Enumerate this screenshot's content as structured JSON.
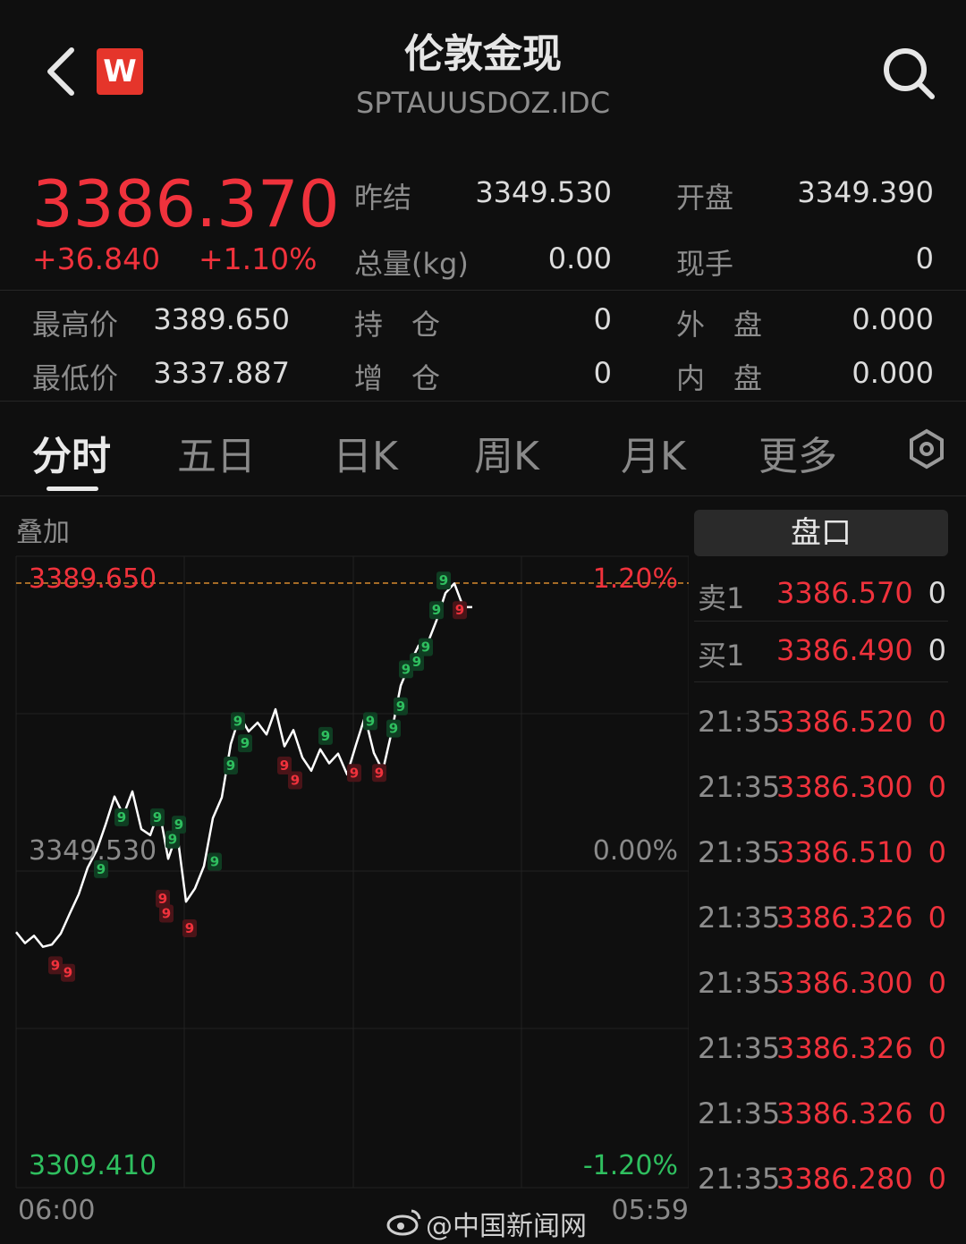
{
  "header": {
    "title": "伦敦金现",
    "subtitle": "SPTAUUSDOZ.IDC",
    "logo_text": "W"
  },
  "quote": {
    "price": "3386.370",
    "change": "+36.840",
    "change_pct": "+1.10%",
    "stats_row1": [
      {
        "label": "昨结",
        "value": "3349.530"
      },
      {
        "label": "开盘",
        "value": "3349.390"
      }
    ],
    "stats_row2": [
      {
        "label": "总量(kg)",
        "value": "0.00"
      },
      {
        "label": "现手",
        "value": "0"
      }
    ],
    "stats_row3": [
      {
        "label": "最高价",
        "value": "3389.650"
      },
      {
        "label": "持　仓",
        "value": "0"
      },
      {
        "label": "外　盘",
        "value": "0.000"
      }
    ],
    "stats_row4": [
      {
        "label": "最低价",
        "value": "3337.887"
      },
      {
        "label": "增　仓",
        "value": "0"
      },
      {
        "label": "内　盘",
        "value": "0.000"
      }
    ]
  },
  "tabs": [
    {
      "label": "分时",
      "active": true
    },
    {
      "label": "五日"
    },
    {
      "label": "日K"
    },
    {
      "label": "周K"
    },
    {
      "label": "月K"
    },
    {
      "label": "更多"
    }
  ],
  "chart": {
    "overlay_label": "叠加",
    "top_price": "3389.650",
    "top_pct": "1.20%",
    "mid_price": "3349.530",
    "mid_pct": "0.00%",
    "bottom_price": "3309.410",
    "bottom_pct": "-1.20%",
    "time_start": "06:00",
    "time_end": "05:59",
    "marker_label": "9"
  },
  "chart_data": {
    "type": "line",
    "xlim": [
      "06:00",
      "05:59"
    ],
    "ylim": [
      3309.41,
      3389.65
    ],
    "reference": 3349.53,
    "high": 3389.65,
    "series": [
      {
        "x": [
          0,
          10,
          20,
          30,
          40,
          50,
          60,
          70,
          80,
          90,
          100,
          110,
          120,
          130,
          140,
          150,
          160,
          170,
          180,
          190,
          200,
          210,
          220,
          230,
          240,
          250,
          260,
          270,
          280,
          290,
          300,
          310,
          320,
          330,
          340,
          350,
          360,
          370,
          380,
          390,
          400,
          410,
          420,
          430,
          440,
          450,
          460,
          470,
          480,
          490,
          500,
          510
        ],
        "values": [
          3342.5,
          3341.0,
          3342.0,
          3340.5,
          3340.8,
          3342.3,
          3345.0,
          3347.6,
          3351.2,
          3353.5,
          3357.0,
          3360.8,
          3358.3,
          3361.5,
          3356.4,
          3355.6,
          3359.0,
          3352.4,
          3355.9,
          3346.6,
          3348.4,
          3351.4,
          3357.9,
          3360.7,
          3367.9,
          3371.7,
          3369.6,
          3370.8,
          3369.2,
          3372.6,
          3367.6,
          3369.8,
          3366.1,
          3364.3,
          3367.2,
          3365.3,
          3366.6,
          3363.8,
          3367.8,
          3371.6,
          3366.7,
          3364.3,
          3369.6,
          3375.8,
          3378.7,
          3381.2,
          3381.5,
          3384.6,
          3388.3,
          3389.6,
          3386.4,
          3386.4
        ]
      }
    ],
    "markers": [
      {
        "type": "buy",
        "label": "9",
        "points": [
          [
            95,
            3351
          ],
          [
            118,
            3358
          ],
          [
            158,
            3358
          ],
          [
            175,
            3355
          ],
          [
            182,
            3357
          ],
          [
            222,
            3352
          ],
          [
            240,
            3365
          ],
          [
            248,
            3371
          ],
          [
            256,
            3368
          ],
          [
            346,
            3369
          ],
          [
            396,
            3371
          ],
          [
            422,
            3370
          ],
          [
            430,
            3373
          ],
          [
            436,
            3378
          ],
          [
            448,
            3379
          ],
          [
            458,
            3381
          ],
          [
            470,
            3386
          ],
          [
            478,
            3390
          ]
        ]
      },
      {
        "type": "sell",
        "label": "9",
        "points": [
          [
            44,
            3338
          ],
          [
            58,
            3337
          ],
          [
            164,
            3347
          ],
          [
            168,
            3345
          ],
          [
            194,
            3343
          ],
          [
            300,
            3365
          ],
          [
            312,
            3363
          ],
          [
            378,
            3364
          ],
          [
            406,
            3364
          ],
          [
            496,
            3386
          ]
        ]
      }
    ]
  },
  "order_book": {
    "title": "盘口",
    "ask": {
      "label": "卖1",
      "price": "3386.570",
      "qty": "0"
    },
    "bid": {
      "label": "买1",
      "price": "3386.490",
      "qty": "0"
    }
  },
  "trades": [
    {
      "time": "21:35",
      "price": "3386.520",
      "qty": "0"
    },
    {
      "time": "21:35",
      "price": "3386.300",
      "qty": "0"
    },
    {
      "time": "21:35",
      "price": "3386.510",
      "qty": "0"
    },
    {
      "time": "21:35",
      "price": "3386.326",
      "qty": "0"
    },
    {
      "time": "21:35",
      "price": "3386.300",
      "qty": "0"
    },
    {
      "time": "21:35",
      "price": "3386.326",
      "qty": "0"
    },
    {
      "time": "21:35",
      "price": "3386.326",
      "qty": "0"
    },
    {
      "time": "21:35",
      "price": "3386.280",
      "qty": "0"
    }
  ],
  "watermark": "@中国新闻网",
  "colors": {
    "up": "#f0323c",
    "down": "#2fbf5f",
    "line": "#ffffff",
    "reference": "#d68a2e"
  }
}
